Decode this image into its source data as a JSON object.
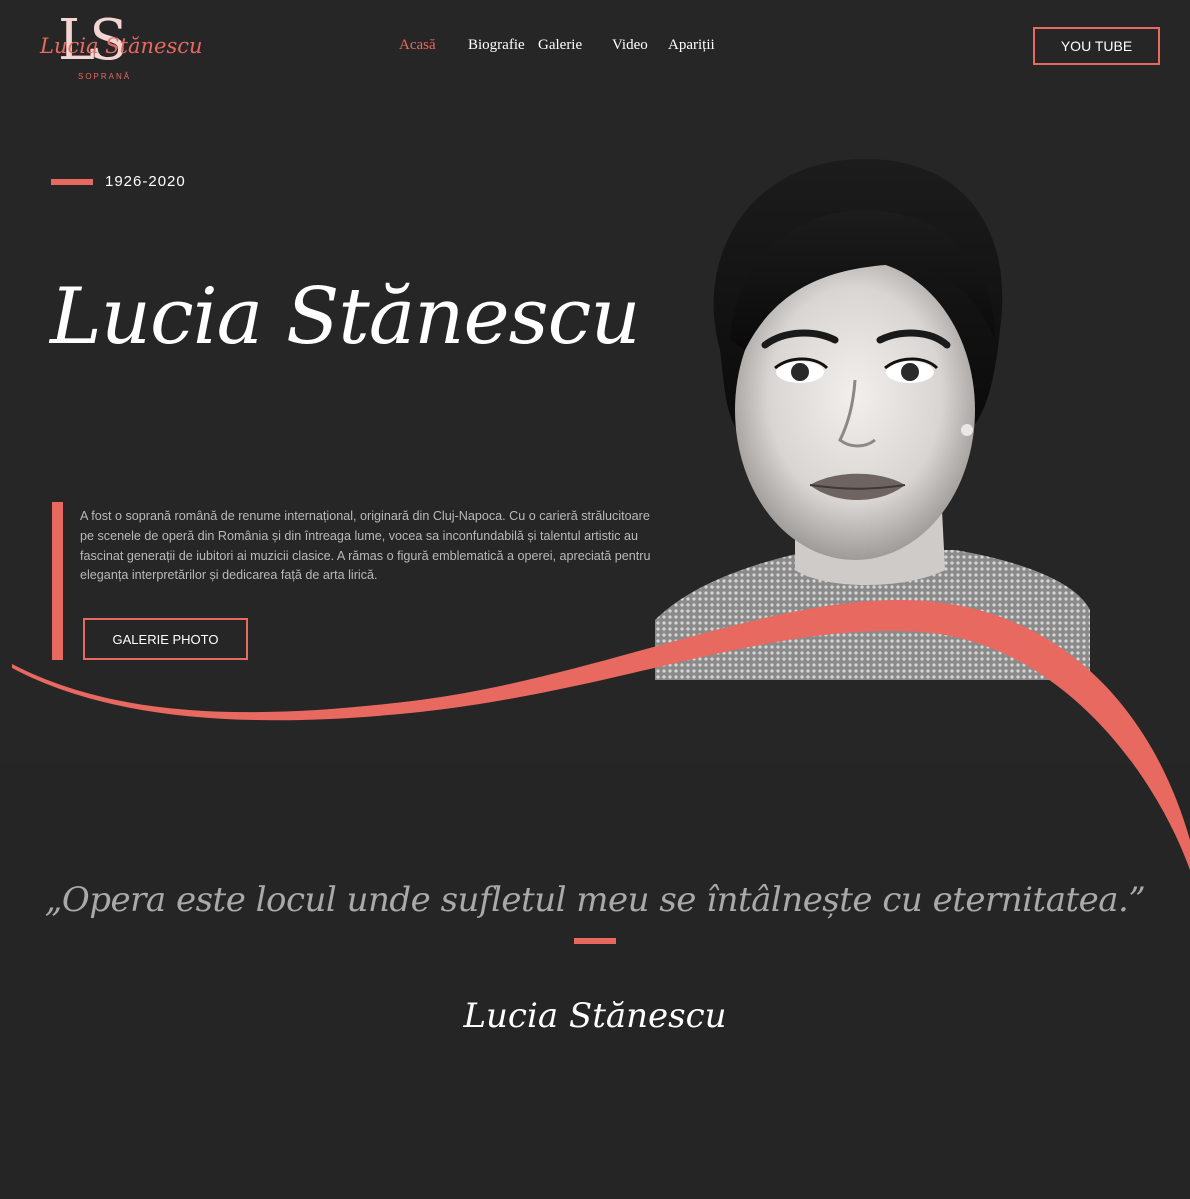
{
  "brand": {
    "monogram": "LS",
    "script_name": "Lucia Stănescu",
    "subtitle": "SOPRANĂ",
    "accent_color": "#e8695f",
    "background_color": "#262627"
  },
  "nav": {
    "items": [
      {
        "label": "Acasă",
        "active": true
      },
      {
        "label": "Biografie",
        "active": false
      },
      {
        "label": "Galerie",
        "active": false
      },
      {
        "label": "Video",
        "active": false
      },
      {
        "label": "Apariții",
        "active": false
      }
    ],
    "cta_label": "YOU TUBE"
  },
  "hero": {
    "years": "1926-2020",
    "name": "Lucia Stănescu",
    "intro": " A fost o soprană română de renume internațional, originară din Cluj-Napoca. Cu o carieră strălucitoare pe scenele de operă din România și din întreaga lume, vocea sa inconfundabilă și talentul artistic au fascinat generații de iubitori ai muzicii clasice. A rămas o figură emblematică a operei, apreciată pentru eleganța interpretărilor și dedicarea față de arta lirică.",
    "gallery_button": "GALERIE PHOTO",
    "portrait_icon": "portrait-photo"
  },
  "quote": {
    "text": "„Opera este locul unde sufletul meu se întâlnește cu eternitatea.”",
    "author": "Lucia Stănescu"
  }
}
